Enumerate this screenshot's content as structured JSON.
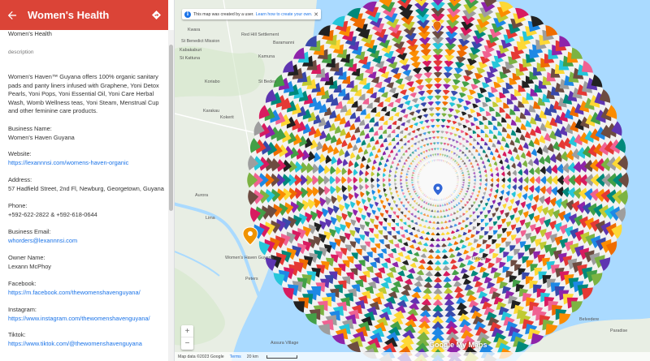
{
  "panel": {
    "title": "Women's Health",
    "layer_name": "Women's Health",
    "description_label": "description",
    "description": "Women's Haven™ Guyana offers 100% organic sanitary pads and panty liners infused with Graphene, Yoni Detox Pearls, Yoni Pops, Yoni Essential Oil, Yoni Care Herbal Wash, Womb Wellness teas, Yoni Steam, Menstrual Cup and other feminine care products.",
    "fields": [
      {
        "label": "Business Name:",
        "value": "Women's Haven Guyana",
        "is_link": false
      },
      {
        "label": "Website:",
        "value": "https://lexannnsi.com/womens-haven-organic",
        "is_link": true
      },
      {
        "label": "Address:",
        "value": "57 Hadfield Street, 2nd Fl, Newburg, Georgetown, Guyana",
        "is_link": false
      },
      {
        "label": "Phone:",
        "value": "+592-622-2822 & +592-618-0644",
        "is_link": false
      },
      {
        "label": "Business Email:",
        "value": "whorders@lexannnsi.com",
        "is_link": true
      },
      {
        "label": "Owner Name:",
        "value": "Lexann McPhoy",
        "is_link": false
      },
      {
        "label": "Facebook:",
        "value": "https://m.facebook.com/thewomenshavenguyana/",
        "is_link": true
      },
      {
        "label": "Instagram:",
        "value": "https://www.instagram.com/thewomenshavenguyana/",
        "is_link": true
      },
      {
        "label": "Tiktok:",
        "value": "https://www.tiktok.com/@thewomenshavenguyana",
        "is_link": true
      }
    ]
  },
  "map": {
    "banner": {
      "text": "This map was created by a user.",
      "link": "Learn how to create your own."
    },
    "places": [
      "Kwara",
      "Red Hill Settlement",
      "Baramanni",
      "St Benedict Mission",
      "Kabakaburi",
      "Kamuna",
      "St Kattuna",
      "Koriabo",
      "St Bedes",
      "Karakau",
      "Kokerit",
      "Aurora",
      "Lima",
      "Women's Haven Guyana",
      "Peters",
      "Assura Village",
      "Paradise",
      "Belvedere",
      "Tarlogie"
    ],
    "zoom_in": "+",
    "zoom_out": "−",
    "attribution": {
      "data": "Map data ©2023 Google",
      "terms": "Terms",
      "scale": "20 km"
    },
    "logo": "Google My Maps"
  },
  "colors": {
    "header": "#db4437",
    "link": "#1a73e8",
    "water": "#aadaff",
    "land": "#e8eee4"
  }
}
